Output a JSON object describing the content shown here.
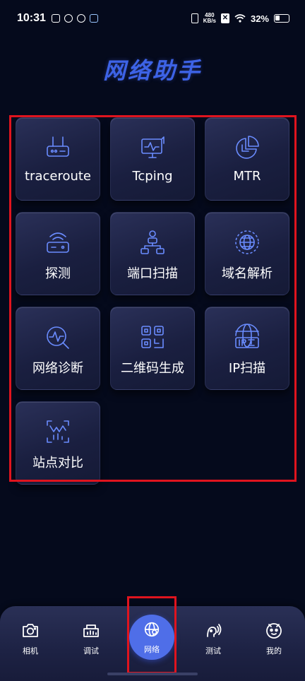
{
  "status_bar": {
    "time": "10:31",
    "net_speed_value": "480",
    "net_speed_unit": "KB/s",
    "battery": "32%"
  },
  "title": "网络助手",
  "tools": [
    {
      "label": "traceroute",
      "icon": "router-icon"
    },
    {
      "label": "Tcping",
      "icon": "monitor-pulse-icon"
    },
    {
      "label": "MTR",
      "icon": "pie-chart-icon"
    },
    {
      "label": "探测",
      "icon": "signal-device-icon"
    },
    {
      "label": "端口扫描",
      "icon": "network-tree-icon"
    },
    {
      "label": "域名解析",
      "icon": "globe-icon"
    },
    {
      "label": "网络诊断",
      "icon": "diagnose-search-icon"
    },
    {
      "label": "二维码生成",
      "icon": "qr-code-icon"
    },
    {
      "label": "IP扫描",
      "icon": "ip-globe-icon"
    },
    {
      "label": "站点对比",
      "icon": "site-compare-icon"
    }
  ],
  "bottom_nav": [
    {
      "label": "相机",
      "icon": "camera-icon",
      "active": false
    },
    {
      "label": "调试",
      "icon": "router-debug-icon",
      "active": false
    },
    {
      "label": "网络",
      "icon": "network-globe-icon",
      "active": true
    },
    {
      "label": "测试",
      "icon": "sound-test-icon",
      "active": false
    },
    {
      "label": "我的",
      "icon": "mascot-face-icon",
      "active": false
    }
  ],
  "colors": {
    "background": "#050a1c",
    "accent": "#4f6ee8",
    "icon_stroke": "#6a8cff",
    "highlight": "#e0141e"
  }
}
